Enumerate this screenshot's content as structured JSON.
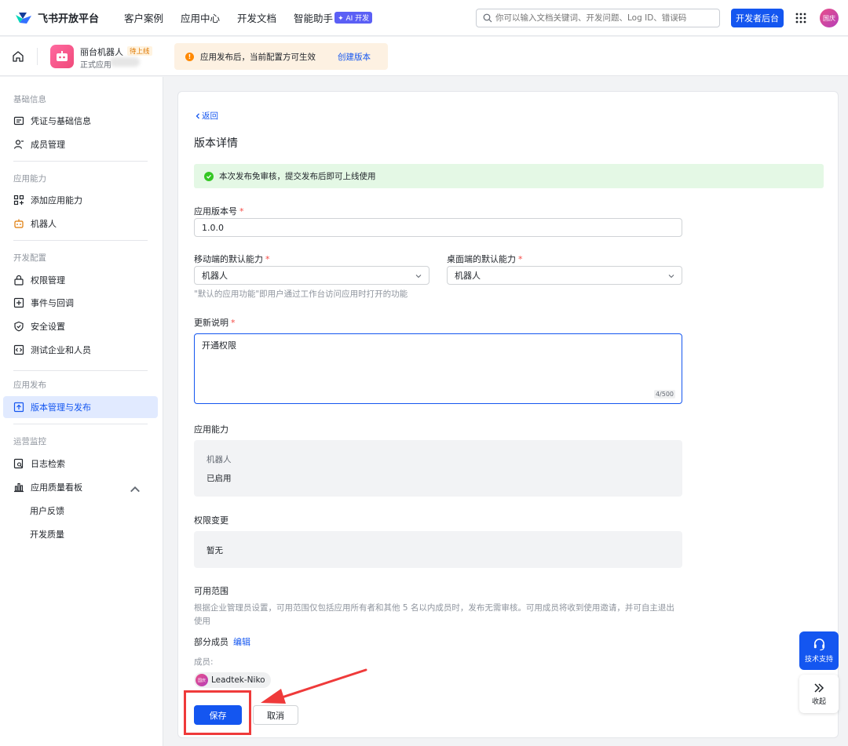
{
  "header": {
    "logo_text": "飞书开放平台",
    "nav": [
      {
        "label": "客户案例"
      },
      {
        "label": "应用中心"
      },
      {
        "label": "开发文档"
      },
      {
        "label": "智能助手",
        "badge": "✦ AI 开发"
      }
    ],
    "search_placeholder": "你可以输入文档关键词、开发问题、Log ID、错误码",
    "dev_console": "开发者后台",
    "avatar_text": "国庆"
  },
  "subheader": {
    "app_name": "丽台机器人",
    "app_status": "待上线",
    "app_sub": "正式应用",
    "notice_icon": "!",
    "notice_text": "应用发布后，当前配置方可生效",
    "notice_link": "创建版本"
  },
  "sidebar": {
    "groups": {
      "basic": "基础信息",
      "ability": "应用能力",
      "dev": "开发配置",
      "release": "应用发布",
      "ops": "运营监控"
    },
    "items": {
      "credentials": "凭证与基础信息",
      "members": "成员管理",
      "add_ability": "添加应用能力",
      "bot": "机器人",
      "permissions": "权限管理",
      "events": "事件与回调",
      "security": "安全设置",
      "test_enterprise": "测试企业和人员",
      "version": "版本管理与发布",
      "log_search": "日志检索",
      "quality_board": "应用质量看板",
      "feedback": "用户反馈",
      "dev_quality": "开发质量"
    }
  },
  "main": {
    "back": "返回",
    "title": "版本详情",
    "success_msg": "本次发布免审核，提交发布后即可上线使用",
    "version_label": "应用版本号",
    "version_value": "1.0.0",
    "mobile_label": "移动端的默认能力",
    "mobile_value": "机器人",
    "desktop_label": "桌面端的默认能力",
    "desktop_value": "机器人",
    "default_hint": "\"默认的应用功能\"即用户通过工作台访问应用时打开的功能",
    "notes_label": "更新说明",
    "notes_value": "开通权限",
    "notes_counter": "4/500",
    "required_mark": "*",
    "ability_title": "应用能力",
    "ability_name": "机器人",
    "ability_status": "已启用",
    "perm_title": "权限变更",
    "perm_value": "暂无",
    "scope_title": "可用范围",
    "scope_desc": "根据企业管理员设置，可用范围仅包括应用所有者和其他 5 名以内成员时，发布无需审核。可用成员将收到使用邀请，并可自主退出使用",
    "scope_mode": "部分成员",
    "scope_edit": "编辑",
    "members_label": "成员:",
    "member_name": "Leadtek-Niko",
    "member_avatar": "国庆",
    "save": "保存",
    "cancel": "取消"
  },
  "floating": {
    "support": "技术支持",
    "collapse": "收起"
  },
  "colors": {
    "primary": "#1456f0",
    "annotation": "#ef3a3a",
    "success": "#34c724",
    "warning": "#ff8800"
  }
}
